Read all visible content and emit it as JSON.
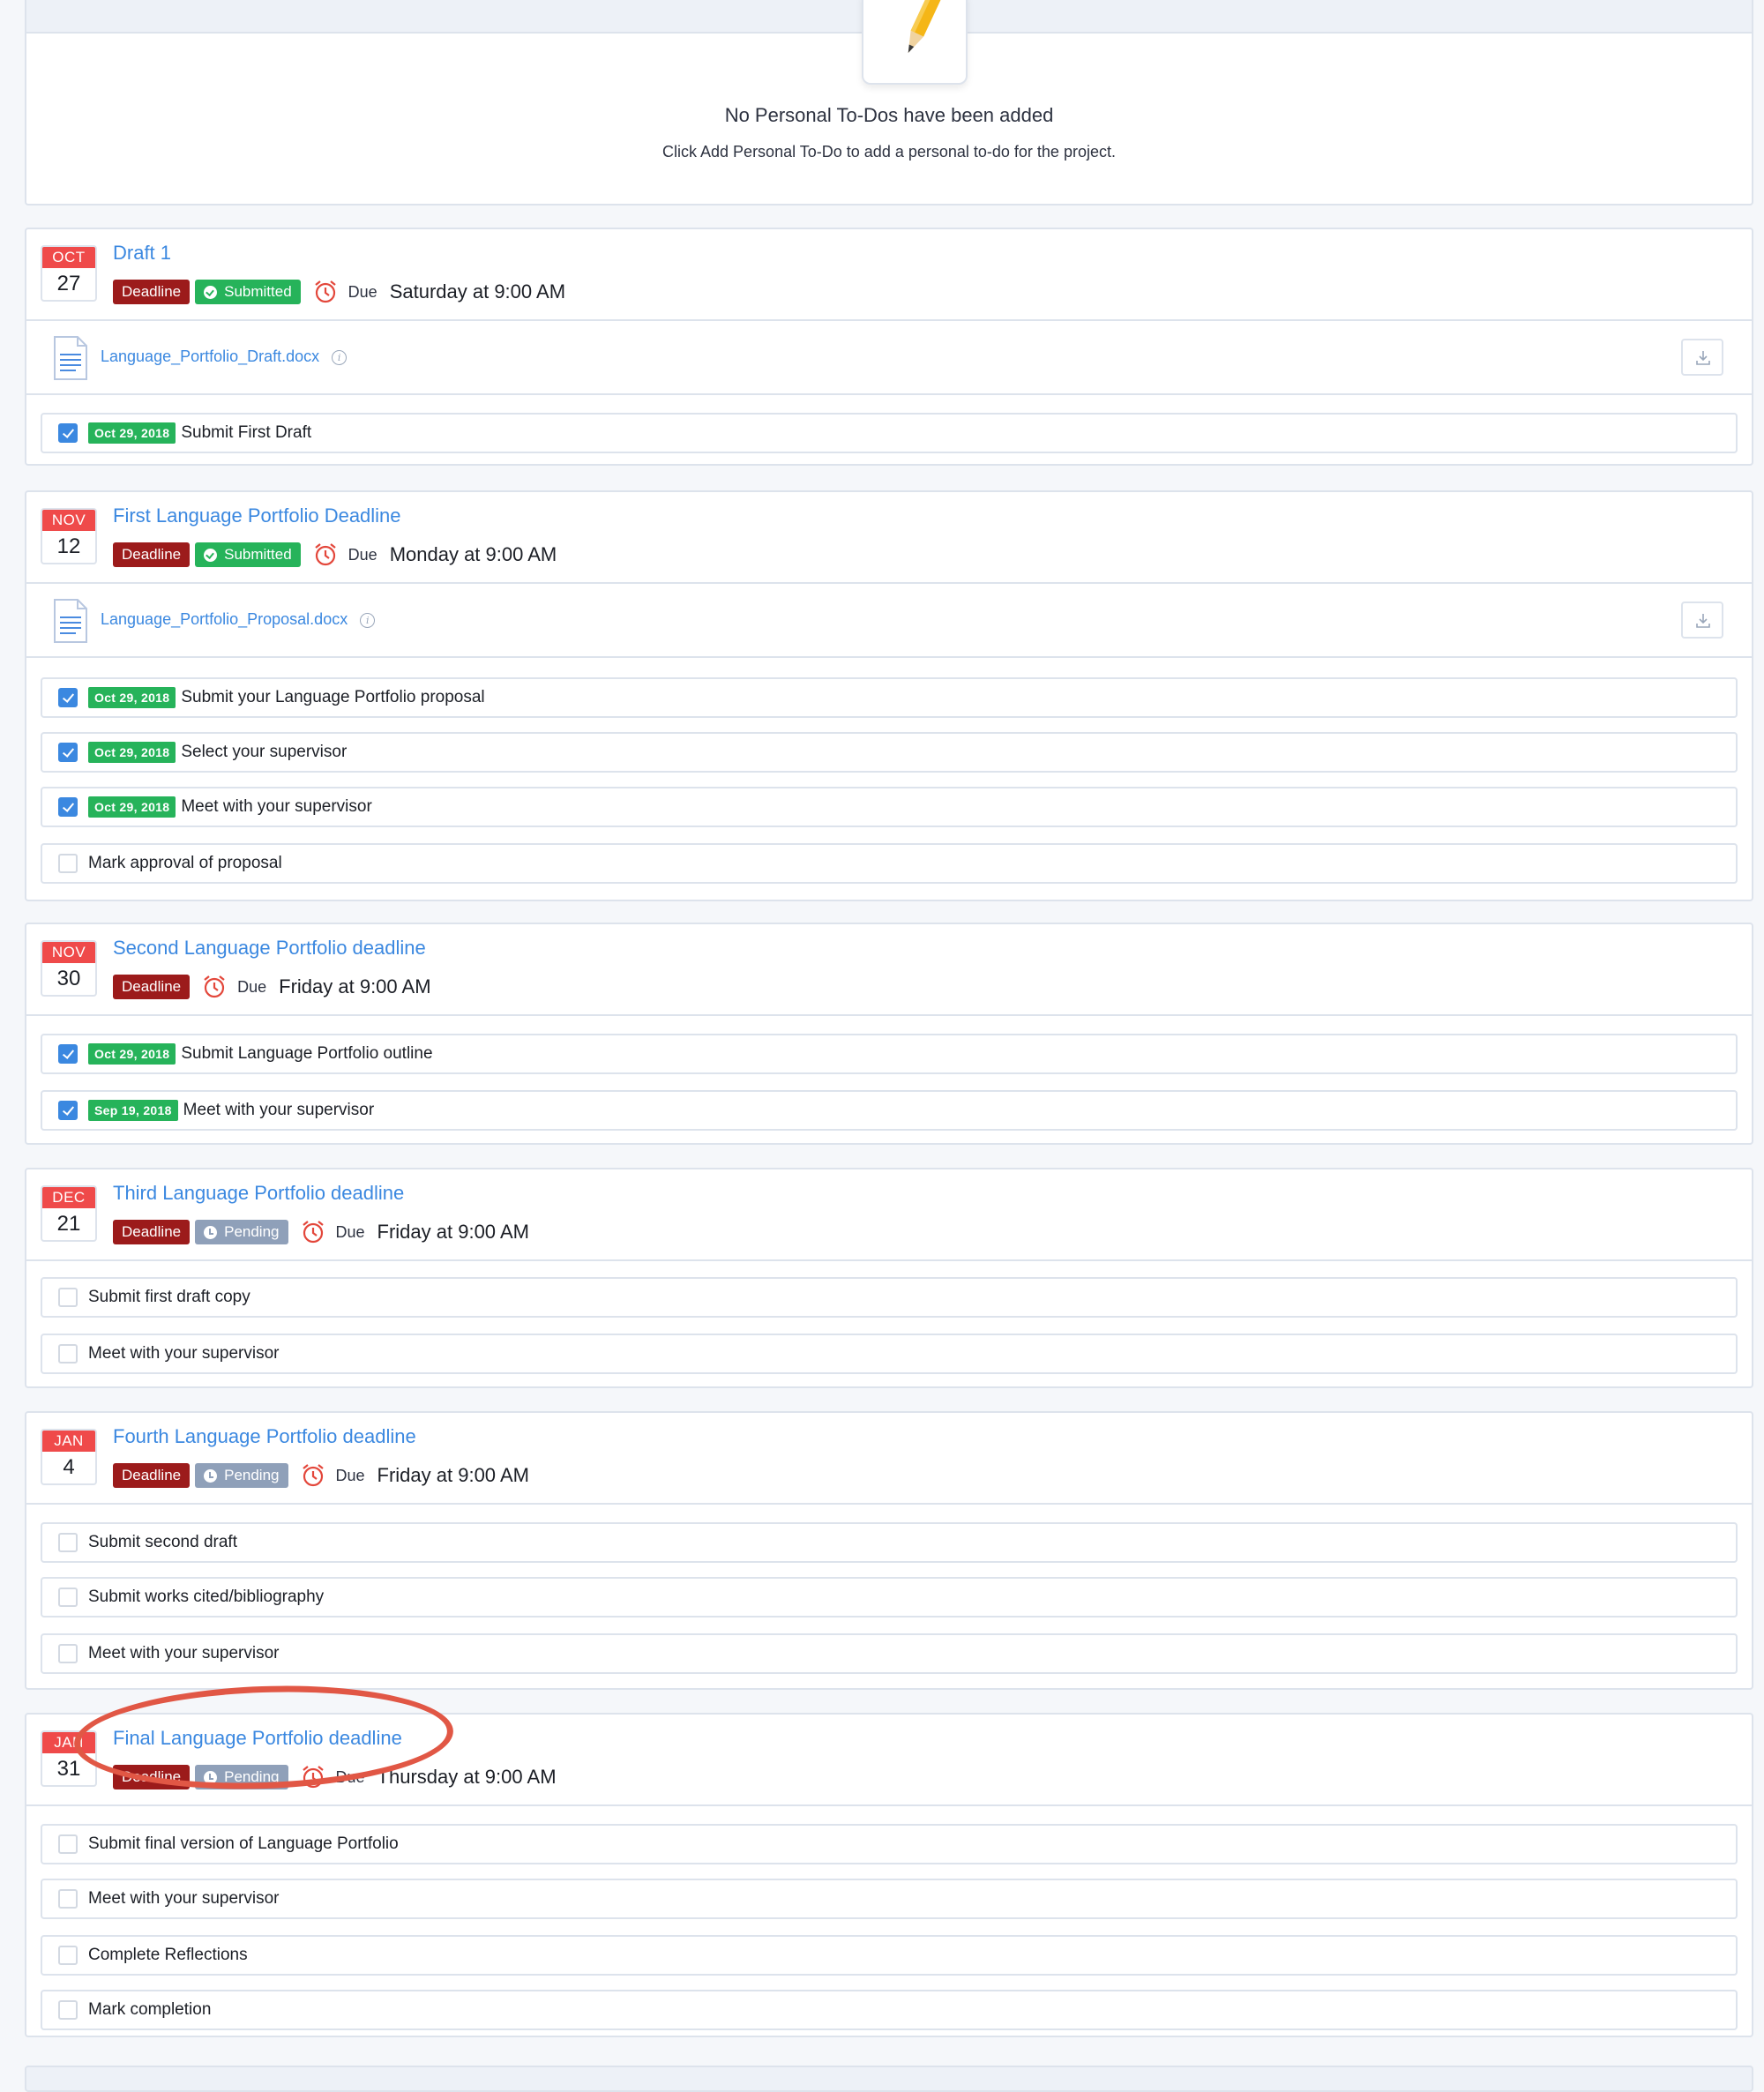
{
  "empty_state": {
    "title": "No Personal To-Dos have been added",
    "subtitle": "Click Add Personal To-Do to add a personal to-do for the project."
  },
  "labels": {
    "due": "Due"
  },
  "events": [
    {
      "month": "OCT",
      "day": "27",
      "title": "Draft 1",
      "badges": {
        "deadline": "Deadline",
        "status": "Submitted"
      },
      "due": "Saturday at 9:00 AM",
      "file": "Language_Portfolio_Draft.docx",
      "tasks": [
        {
          "date": "Oct 29, 2018",
          "label": "Submit First Draft",
          "checked": true
        }
      ]
    },
    {
      "month": "NOV",
      "day": "12",
      "title": "First Language Portfolio Deadline",
      "badges": {
        "deadline": "Deadline",
        "status": "Submitted"
      },
      "due": "Monday at 9:00 AM",
      "file": "Language_Portfolio_Proposal.docx",
      "tasks": [
        {
          "date": "Oct 29, 2018",
          "label": "Submit your Language Portfolio proposal",
          "checked": true
        },
        {
          "date": "Oct 29, 2018",
          "label": "Select your supervisor",
          "checked": true
        },
        {
          "date": "Oct 29, 2018",
          "label": "Meet with your supervisor",
          "checked": true
        },
        {
          "date": "",
          "label": "Mark approval of proposal",
          "checked": false
        }
      ]
    },
    {
      "month": "NOV",
      "day": "30",
      "title": "Second Language Portfolio deadline",
      "badges": {
        "deadline": "Deadline",
        "status": ""
      },
      "due": "Friday at 9:00 AM",
      "file": "",
      "tasks": [
        {
          "date": "Oct 29, 2018",
          "label": "Submit Language Portfolio outline",
          "checked": true
        },
        {
          "date": "Sep 19, 2018",
          "label": "Meet with your supervisor",
          "checked": true
        }
      ]
    },
    {
      "month": "DEC",
      "day": "21",
      "title": "Third Language Portfolio deadline",
      "badges": {
        "deadline": "Deadline",
        "status": "Pending"
      },
      "due": "Friday at 9:00 AM",
      "file": "",
      "tasks": [
        {
          "date": "",
          "label": "Submit first draft copy",
          "checked": false
        },
        {
          "date": "",
          "label": "Meet with your supervisor",
          "checked": false
        }
      ]
    },
    {
      "month": "JAN",
      "day": "4",
      "title": "Fourth Language Portfolio deadline",
      "badges": {
        "deadline": "Deadline",
        "status": "Pending"
      },
      "due": "Friday at 9:00 AM",
      "file": "",
      "tasks": [
        {
          "date": "",
          "label": "Submit second draft",
          "checked": false
        },
        {
          "date": "",
          "label": "Submit works cited/bibliography",
          "checked": false
        },
        {
          "date": "",
          "label": "Meet with your supervisor",
          "checked": false
        }
      ]
    },
    {
      "month": "JAN",
      "day": "31",
      "title": "Final Language Portfolio deadline",
      "badges": {
        "deadline": "Deadline",
        "status": "Pending"
      },
      "due": "Thursday at 9:00 AM",
      "file": "",
      "tasks": [
        {
          "date": "",
          "label": "Submit final version of Language Portfolio",
          "checked": false
        },
        {
          "date": "",
          "label": "Meet with your supervisor",
          "checked": false
        },
        {
          "date": "",
          "label": "Complete Reflections",
          "checked": false
        },
        {
          "date": "",
          "label": "Mark completion",
          "checked": false
        }
      ]
    }
  ],
  "colors": {
    "accent_link": "#3b88e0",
    "calendar_month": "#ef4a4a",
    "deadline_badge": "#9c1b1b",
    "submitted_badge": "#26b35a",
    "pending_badge": "#8fa0b9",
    "highlight_ring": "#e15745"
  },
  "icons": {
    "empty_state": "pencil-icon",
    "due": "alarm-clock-icon",
    "file": "document-icon",
    "file_info": "info-icon",
    "download": "download-icon",
    "checkbox_checked": "checkmark-icon"
  }
}
